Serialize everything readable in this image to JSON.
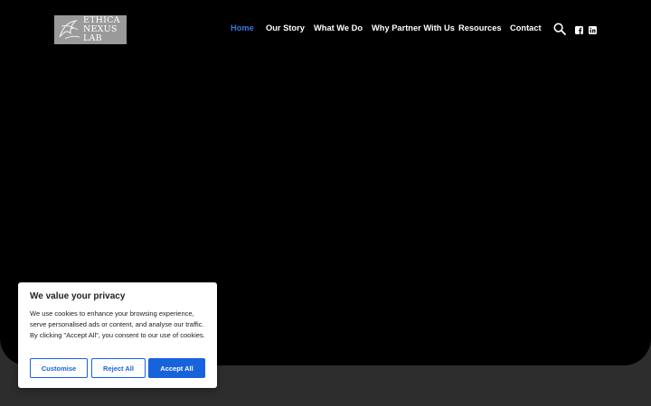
{
  "brand": {
    "logo_lines": [
      "ETHICA",
      "NEXUS",
      "LAB"
    ]
  },
  "nav": {
    "items": [
      {
        "label": "Home",
        "active": true
      },
      {
        "label": "Our Story",
        "active": false
      },
      {
        "label": "What We Do",
        "active": false
      },
      {
        "label": "Why Partner With Us",
        "active": false
      },
      {
        "label": "Resources",
        "active": false
      },
      {
        "label": "Contact",
        "active": false
      }
    ],
    "icons": [
      "search-icon",
      "facebook-icon",
      "linkedin-icon"
    ]
  },
  "cookie_banner": {
    "title": "We value your privacy",
    "body": "We use cookies to enhance your browsing experience, serve personalised ads or content, and analyse our traffic. By clicking \"Accept All\", you consent to our use of cookies.",
    "buttons": {
      "customise": "Customise",
      "reject": "Reject All",
      "accept": "Accept All"
    }
  },
  "colors": {
    "hero_background": "#000000",
    "page_background": "#2d2d2d",
    "nav_active": "#3b74dc",
    "accent_button": "#1863dc"
  }
}
